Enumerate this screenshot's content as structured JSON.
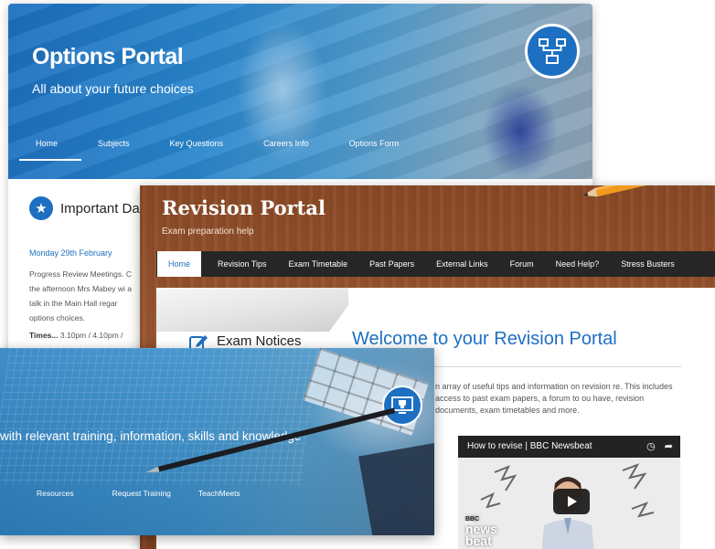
{
  "options_portal": {
    "title": "Options Portal",
    "subtitle": "All about your future choices",
    "nav": [
      "Home",
      "Subjects",
      "Key Questions",
      "Careers Info",
      "Options Form"
    ],
    "badge_icon": "sitemap-icon",
    "important_title": "Important Da",
    "date": "Monday 29th February",
    "paragraph": "Progress Review Meetings. C the afternoon Mrs Mabey wi a talk in the Main Hall regar options choices.",
    "times_label": "Times...",
    "times_value": "3.10pm / 4.10pm /"
  },
  "revision_portal": {
    "title": "Revision Portal",
    "subtitle": "Exam preparation help",
    "nav": [
      "Home",
      "Revision Tips",
      "Exam Timetable",
      "Past Papers",
      "External Links",
      "Forum",
      "Need Help?",
      "Stress Busters"
    ],
    "notices_title": "Exam Notices",
    "welcome": "Welcome to your Revision Portal",
    "body": "n array of useful tips and information on revision re. This includes access to past exam papers, a forum to ou have, revision documents, exam timetables and more.",
    "video": {
      "title": "How to revise | BBC Newsbeat",
      "brand_top": "BBC",
      "brand_line1": "news",
      "brand_line2": "beat"
    }
  },
  "training_portal": {
    "tagline": "with relevant training, information, skills and knowledge",
    "nav": [
      "Resources",
      "Request Training",
      "TeachMeets"
    ],
    "badge_icon": "trophy-screen-icon"
  },
  "colors": {
    "brand_blue": "#1d6fc2",
    "nav_dark": "#262626",
    "wood": "#8a4a26"
  }
}
